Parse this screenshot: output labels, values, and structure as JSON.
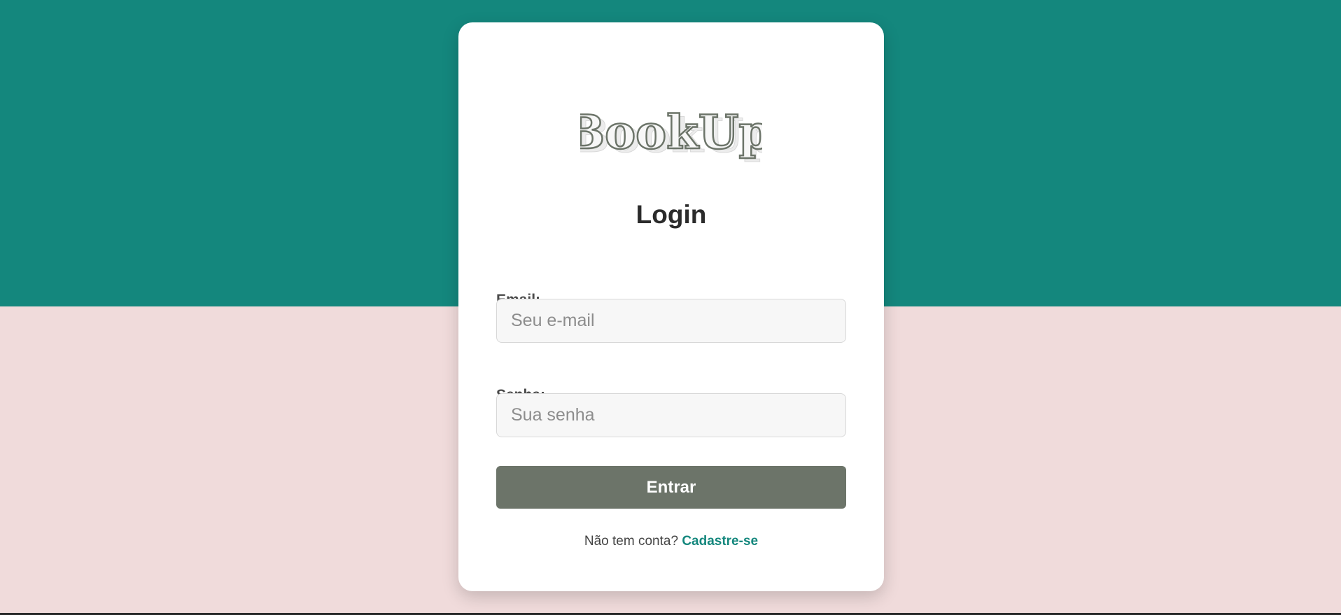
{
  "colors": {
    "top_background": "#14877d",
    "bottom_background": "#f0dbdb",
    "button": "#6c7469",
    "link": "#14877d"
  },
  "logo": {
    "text": "BookUp"
  },
  "form": {
    "title": "Login",
    "email_label": "Email:",
    "email_placeholder": "Seu e-mail",
    "password_label": "Senha:",
    "password_placeholder": "Sua senha",
    "submit_label": "Entrar"
  },
  "footer": {
    "prompt": "Não tem conta?",
    "signup_link": "Cadastre-se"
  }
}
